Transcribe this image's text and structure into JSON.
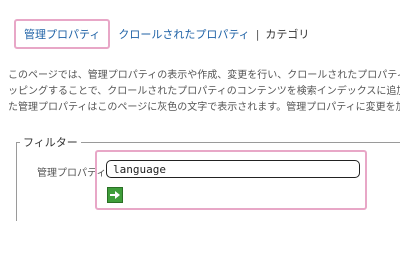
{
  "tabs": {
    "managed_properties": "管理プロパティ",
    "crawled_properties": "クロールされたプロパティ",
    "separator": "|",
    "categories": "カテゴリ"
  },
  "description": {
    "line1": "このページでは、管理プロパティの表示や作成、変更を行い、クロールされたプロパティを管",
    "line2": "ッピングすることで、クロールされたプロパティのコンテンツを検索インデックスに追加します。こ",
    "line3": "た管理プロパティはこのページに灰色の文字で表示されます。管理プロパティに変更を加え"
  },
  "filter": {
    "legend": "フィルター",
    "label": "管理プロパティ",
    "input_value": "language"
  },
  "colors": {
    "link": "#1f62a6",
    "highlight": "#e8a7c7",
    "go_button": "#3f9d3a"
  },
  "icons": {
    "go": "arrow-right-icon"
  }
}
